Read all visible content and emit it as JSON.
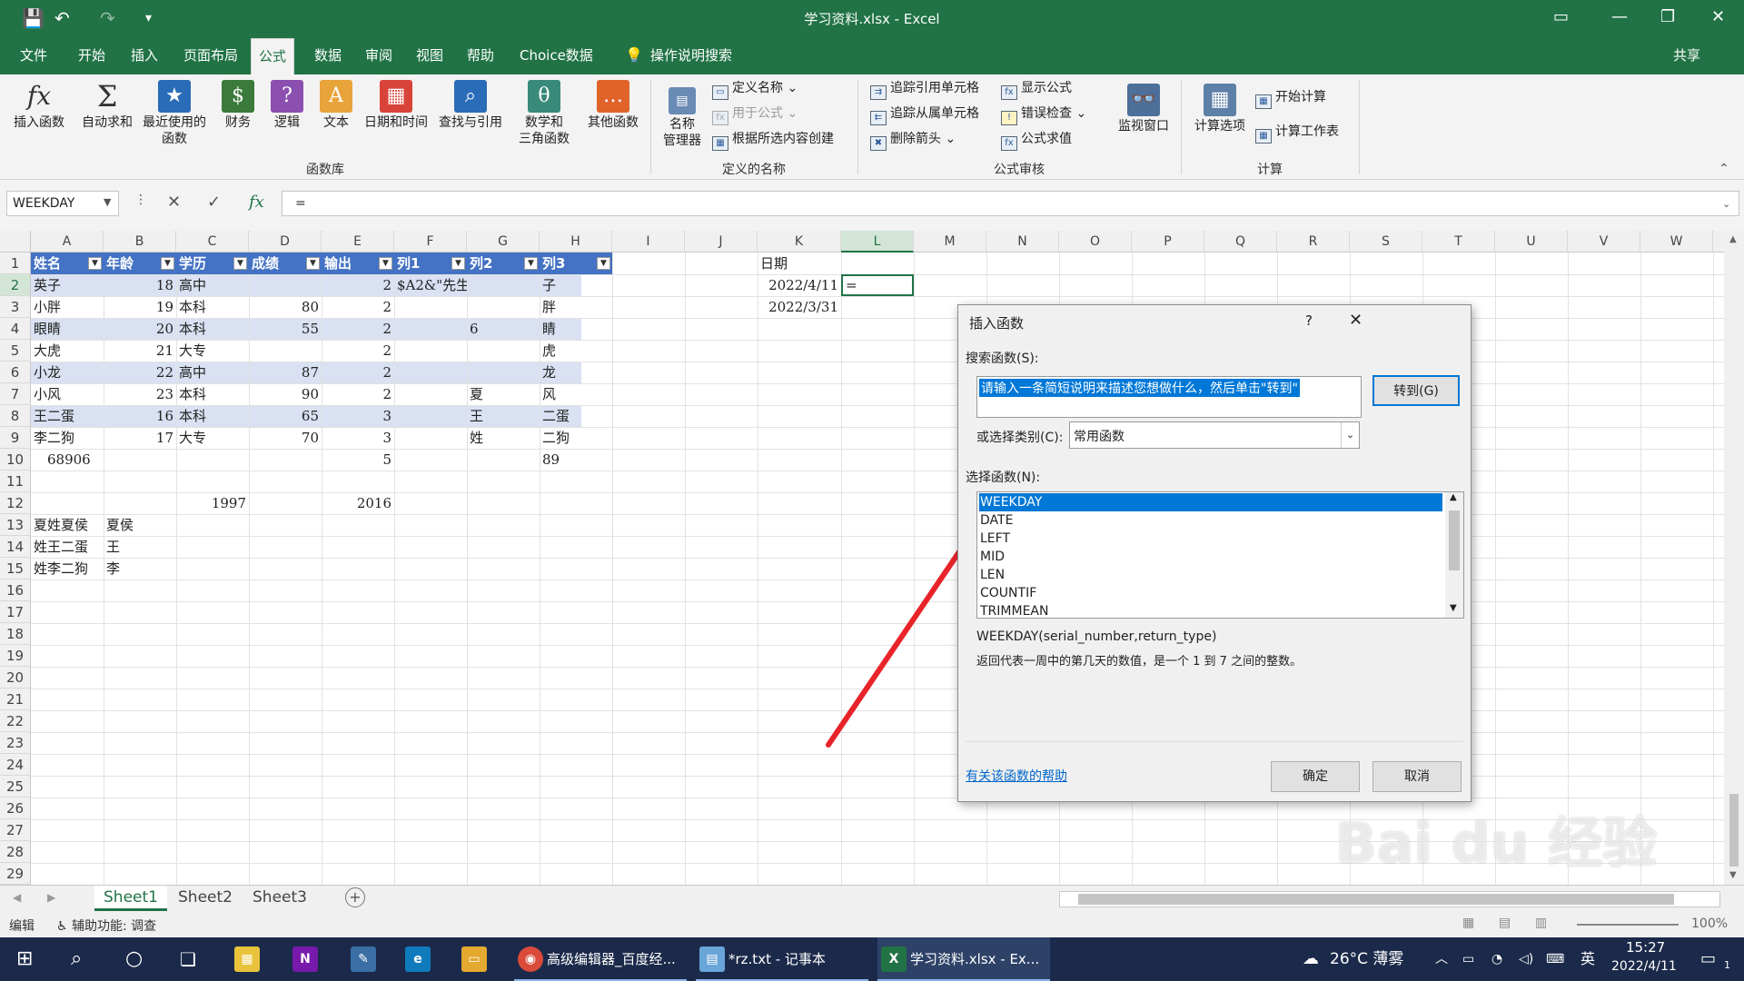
{
  "window": {
    "title": "学习资料.xlsx - Excel"
  },
  "tabs": [
    {
      "label": "文件"
    },
    {
      "label": "开始"
    },
    {
      "label": "插入"
    },
    {
      "label": "页面布局"
    },
    {
      "label": "公式"
    },
    {
      "label": "数据"
    },
    {
      "label": "审阅"
    },
    {
      "label": "视图"
    },
    {
      "label": "帮助"
    },
    {
      "label": "Choice数据"
    },
    {
      "label": "操作说明搜索"
    },
    {
      "label": "共享"
    }
  ],
  "ribbon": {
    "insert_function": "插入函数",
    "autosum": "自动求和",
    "recent": "最近使用的",
    "recent2": "函数",
    "finance": "财务",
    "logic": "逻辑",
    "text": "文本",
    "datetime": "日期和时间",
    "lookup": "查找与引用",
    "math": "数学和",
    "math2": "三角函数",
    "other": "其他函数",
    "function_library": "函数库",
    "name_manager": "名称",
    "name_manager2": "管理器",
    "define_name": "定义名称",
    "use_in_formula": "用于公式",
    "create_from_sel": "根据所选内容创建",
    "defined_names": "定义的名称",
    "trace_prec": "追踪引用单元格",
    "trace_dep": "追踪从属单元格",
    "remove_arrows": "删除箭头",
    "show_formulas": "显示公式",
    "error_check": "错误检查",
    "eval_formula": "公式求值",
    "watch": "监视窗口",
    "formula_auditing": "公式审核",
    "calc_options": "计算选项",
    "calc_now": "开始计算",
    "calc_sheet": "计算工作表",
    "calculation": "计算"
  },
  "formula_bar": {
    "name_box": "WEEKDAY",
    "formula": "="
  },
  "columns": [
    "A",
    "B",
    "C",
    "D",
    "E",
    "F",
    "G",
    "H",
    "I",
    "J",
    "K",
    "L",
    "M",
    "N",
    "O",
    "P",
    "Q",
    "R",
    "S",
    "T",
    "U",
    "V",
    "W"
  ],
  "rows": [
    "1",
    "2",
    "3",
    "4",
    "5",
    "6",
    "7",
    "8",
    "9",
    "10",
    "11",
    "12",
    "13",
    "14",
    "15",
    "16",
    "17",
    "18",
    "19",
    "20",
    "21",
    "22",
    "23",
    "24",
    "25",
    "26",
    "27",
    "28",
    "29"
  ],
  "headers": [
    "姓名",
    "年龄",
    "学历",
    "成绩",
    "输出",
    "列1",
    "列2",
    "列3"
  ],
  "table": [
    [
      "英子",
      "18",
      "高中",
      "",
      "2",
      "$A2&\"先生\"",
      "",
      "子"
    ],
    [
      "小胖",
      "19",
      "本科",
      "80",
      "2",
      "",
      "",
      "胖"
    ],
    [
      "眼睛",
      "20",
      "本科",
      "55",
      "2",
      "",
      "6",
      "睛"
    ],
    [
      "大虎",
      "21",
      "大专",
      "",
      "2",
      "",
      "",
      "虎"
    ],
    [
      "小龙",
      "22",
      "高中",
      "87",
      "2",
      "",
      "",
      "龙"
    ],
    [
      "小风",
      "23",
      "本科",
      "90",
      "2",
      "",
      "夏",
      "风"
    ],
    [
      "王二蛋",
      "16",
      "本科",
      "65",
      "3",
      "",
      "王",
      "二蛋"
    ],
    [
      "李二狗",
      "17",
      "大专",
      "70",
      "3",
      "",
      "姓",
      "二狗"
    ]
  ],
  "total_row": {
    "a": "68906",
    "e": "5",
    "h": "89"
  },
  "row12": {
    "c": "1997",
    "e": "2016"
  },
  "rows13_15": [
    [
      "夏姓夏侯",
      "夏侯"
    ],
    [
      "姓王二蛋",
      "王"
    ],
    [
      "姓李二狗",
      "李"
    ]
  ],
  "dates": {
    "header": "日期",
    "d1": "2022/4/11",
    "d2": "2022/3/31",
    "active": "="
  },
  "sheets": [
    "Sheet1",
    "Sheet2",
    "Sheet3"
  ],
  "status": {
    "mode": "编辑",
    "accessibility": "辅助功能: 调查",
    "zoom": "100%"
  },
  "dialog": {
    "title": "插入函数",
    "help": "?",
    "close": "✕",
    "search_label": "搜索函数(S):",
    "search_value": "请输入一条简短说明来描述您想做什么，然后单击\"转到\"",
    "go": "转到(G)",
    "category_label": "或选择类别(C):",
    "category": "常用函数",
    "select_label": "选择函数(N):",
    "functions": [
      "WEEKDAY",
      "DATE",
      "LEFT",
      "MID",
      "LEN",
      "COUNTIF",
      "TRIMMEAN"
    ],
    "signature": "WEEKDAY(serial_number,return_type)",
    "description": "返回代表一周中的第几天的数值，是一个 1 到 7 之间的整数。",
    "help_link": "有关该函数的帮助",
    "ok": "确定",
    "cancel": "取消"
  },
  "taskbar": {
    "app1": "高级编辑器_百度经...",
    "app2": "*rz.txt - 记事本",
    "app3": "学习资料.xlsx - Ex...",
    "weather": "26°C 薄雾",
    "ime": "英",
    "time": "15:27",
    "date": "2022/4/11",
    "notif": "1"
  },
  "watermark": "Bai du 经验"
}
